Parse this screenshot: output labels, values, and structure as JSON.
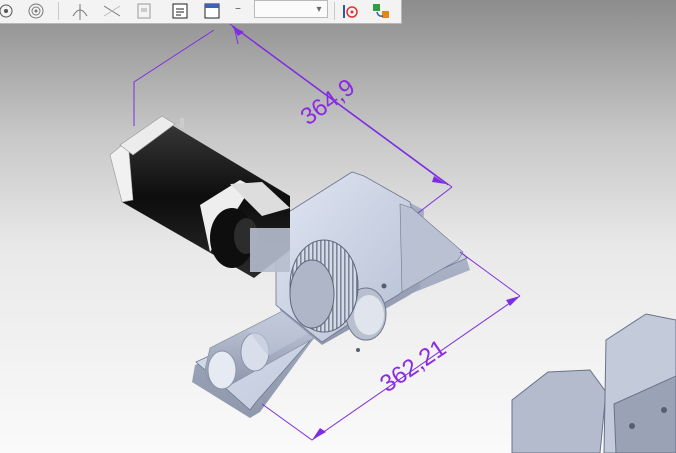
{
  "app": {
    "toolbar": {
      "separator_glyph": "–",
      "zoom_value": "",
      "icons": [
        "view-front-icon",
        "view-target-icon",
        "rotate-view-icon",
        "measure-icon",
        "assembly-icon",
        "properties-icon",
        "window-icon",
        "snap-point-icon",
        "color-component-icon"
      ]
    },
    "viewport": {
      "dimensions": [
        {
          "label": "364,9"
        },
        {
          "label": "362,21"
        }
      ],
      "colors": {
        "dimension": "#7d2ee0",
        "part": "#c9d2e4",
        "motor": "#151515",
        "motor_cap": "#f2f2f2"
      }
    }
  }
}
